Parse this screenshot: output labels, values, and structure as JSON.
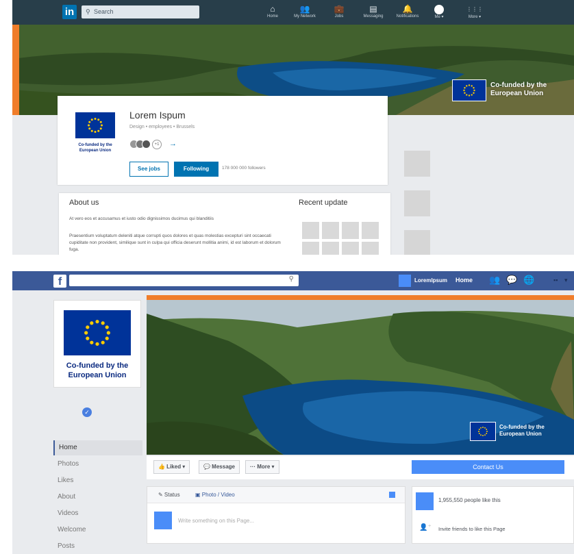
{
  "linkedin": {
    "logo": "in",
    "search_placeholder": "Search",
    "nav": [
      {
        "label": "Home",
        "icon": "⌂"
      },
      {
        "label": "My Network",
        "icon": "👥"
      },
      {
        "label": "Jobs",
        "icon": "💼"
      },
      {
        "label": "Messaging",
        "icon": "▤"
      },
      {
        "label": "Notifications",
        "icon": "🔔"
      },
      {
        "label": "Me ▾",
        "icon": ""
      },
      {
        "label": "More ▾",
        "icon": "⋮⋮⋮"
      }
    ],
    "cover_badge_text": "Co-funded by the European Union",
    "company_name": "Lorem Ispum",
    "company_meta": "Design • employees • Brussels",
    "logo_text": "Co-funded by the European Union",
    "connections_plus": "+1",
    "see_jobs": "See jobs",
    "following": "Following",
    "followers": "178 000 000 followers",
    "about_heading": "About us",
    "about_p1": "At vero eos et accusamus et iusto odio dignissimos ducimus qui blanditiis",
    "about_p2": "Praesentium voluptatum deleniti atque corrupti quos dolores et quas molestias excepturi sint occaecati cupiditate non provident, similique sunt in culpa qui officia deserunt mollitia animi, id est laborum et dolorum fuga.",
    "recent_heading": "Recent update"
  },
  "facebook": {
    "logo": "f",
    "search_icon": "⚲",
    "page_name": "Loremlpsum",
    "home": "Home",
    "profile_text": "Co-funded by the European Union",
    "cover_badge_text": "Co-funded by the European Union",
    "sidebar": [
      "Home",
      "Photos",
      "Likes",
      "About",
      "Videos",
      "Welcome",
      "Posts"
    ],
    "liked": "👍 Liked ▾",
    "message": "💬 Message",
    "more": "··· More ▾",
    "contact": "Contact Us",
    "status": "✎  Status",
    "photo_video": "▣  Photo / Video",
    "composer_placeholder": "Write something on this Page...",
    "likes_count": "1,955,550 people like this",
    "invite": "Invite friends to like this Page"
  },
  "colors": {
    "linkedin_nav": "#283e4a",
    "linkedin_blue": "#0073b1",
    "facebook_blue": "#3b5998",
    "accent_orange": "#f07d2a",
    "eu_blue": "#003399",
    "eu_yellow": "#ffcc00"
  }
}
